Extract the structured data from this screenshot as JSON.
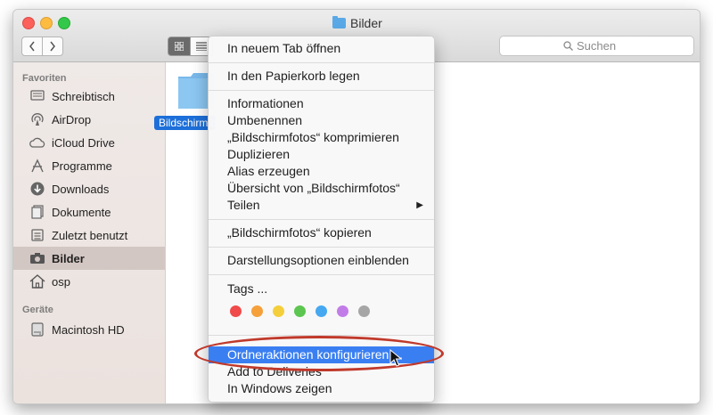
{
  "window": {
    "title": "Bilder"
  },
  "toolbar": {
    "back_icon": "chevron-left-icon",
    "forward_icon": "chevron-right-icon",
    "view_icon_active": "icon-view-icon",
    "view_list": "list-view-icon"
  },
  "search": {
    "placeholder": "Suchen"
  },
  "sidebar": {
    "favorites_header": "Favoriten",
    "devices_header": "Geräte",
    "items": [
      {
        "label": "Schreibtisch",
        "icon": "desktop-icon"
      },
      {
        "label": "AirDrop",
        "icon": "airdrop-icon"
      },
      {
        "label": "iCloud Drive",
        "icon": "cloud-icon"
      },
      {
        "label": "Programme",
        "icon": "applications-icon"
      },
      {
        "label": "Downloads",
        "icon": "download-icon"
      },
      {
        "label": "Dokumente",
        "icon": "documents-icon"
      },
      {
        "label": "Zuletzt benutzt",
        "icon": "recents-icon"
      },
      {
        "label": "Bilder",
        "icon": "camera-icon",
        "selected": true
      },
      {
        "label": "osp",
        "icon": "home-icon"
      }
    ],
    "devices": [
      {
        "label": "Macintosh HD",
        "icon": "hard-drive-icon"
      }
    ]
  },
  "content": {
    "selected_file_label": "Bildschirmfotos"
  },
  "context_menu": {
    "open_new_tab": "In neuem Tab öffnen",
    "move_to_trash": "In den Papierkorb legen",
    "get_info": "Informationen",
    "rename": "Umbenennen",
    "compress": "„Bildschirmfotos“ komprimieren",
    "duplicate": "Duplizieren",
    "make_alias": "Alias erzeugen",
    "quick_look": "Übersicht von „Bildschirmfotos“",
    "share": "Teilen",
    "copy": "„Bildschirmfotos“ kopieren",
    "show_view_options": "Darstellungsoptionen einblenden",
    "tags": "Tags ...",
    "tag_colors": [
      "#f04a4a",
      "#f5a03a",
      "#f5cf3b",
      "#5cc650",
      "#46a8f0",
      "#c27ce8",
      "#a6a6a6"
    ],
    "folder_actions": "Ordneraktionen konfigurieren ...",
    "add_to_deliveries": "Add to Deliveries",
    "show_in_windows": "In Windows zeigen"
  },
  "colors": {
    "highlight": "#3a7ff2",
    "annotation_oval": "#c0392b"
  }
}
